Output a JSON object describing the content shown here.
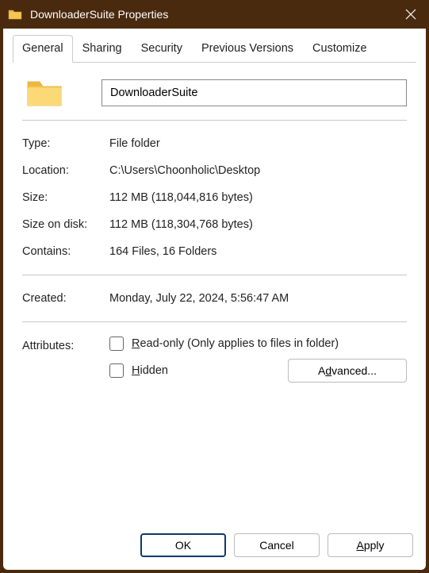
{
  "titlebar": {
    "title": "DownloaderSuite Properties"
  },
  "tabs": {
    "general": "General",
    "sharing": "Sharing",
    "security": "Security",
    "previous_versions": "Previous Versions",
    "customize": "Customize"
  },
  "general": {
    "name_value": "DownloaderSuite",
    "type_label": "Type:",
    "type_value": "File folder",
    "location_label": "Location:",
    "location_value": "C:\\Users\\Choonholic\\Desktop",
    "size_label": "Size:",
    "size_value": "112 MB (118,044,816 bytes)",
    "size_on_disk_label": "Size on disk:",
    "size_on_disk_value": "112 MB (118,304,768 bytes)",
    "contains_label": "Contains:",
    "contains_value": "164 Files, 16 Folders",
    "created_label": "Created:",
    "created_value": "Monday, July 22, 2024, 5:56:47 AM",
    "attributes_label": "Attributes:",
    "readonly_suffix": "ead-only (Only applies to files in folder)",
    "hidden_suffix": "idden",
    "advanced_prefix": "A",
    "advanced_suffix": "vanced..."
  },
  "buttons": {
    "ok": "OK",
    "cancel": "Cancel",
    "apply_suffix": "pply"
  }
}
